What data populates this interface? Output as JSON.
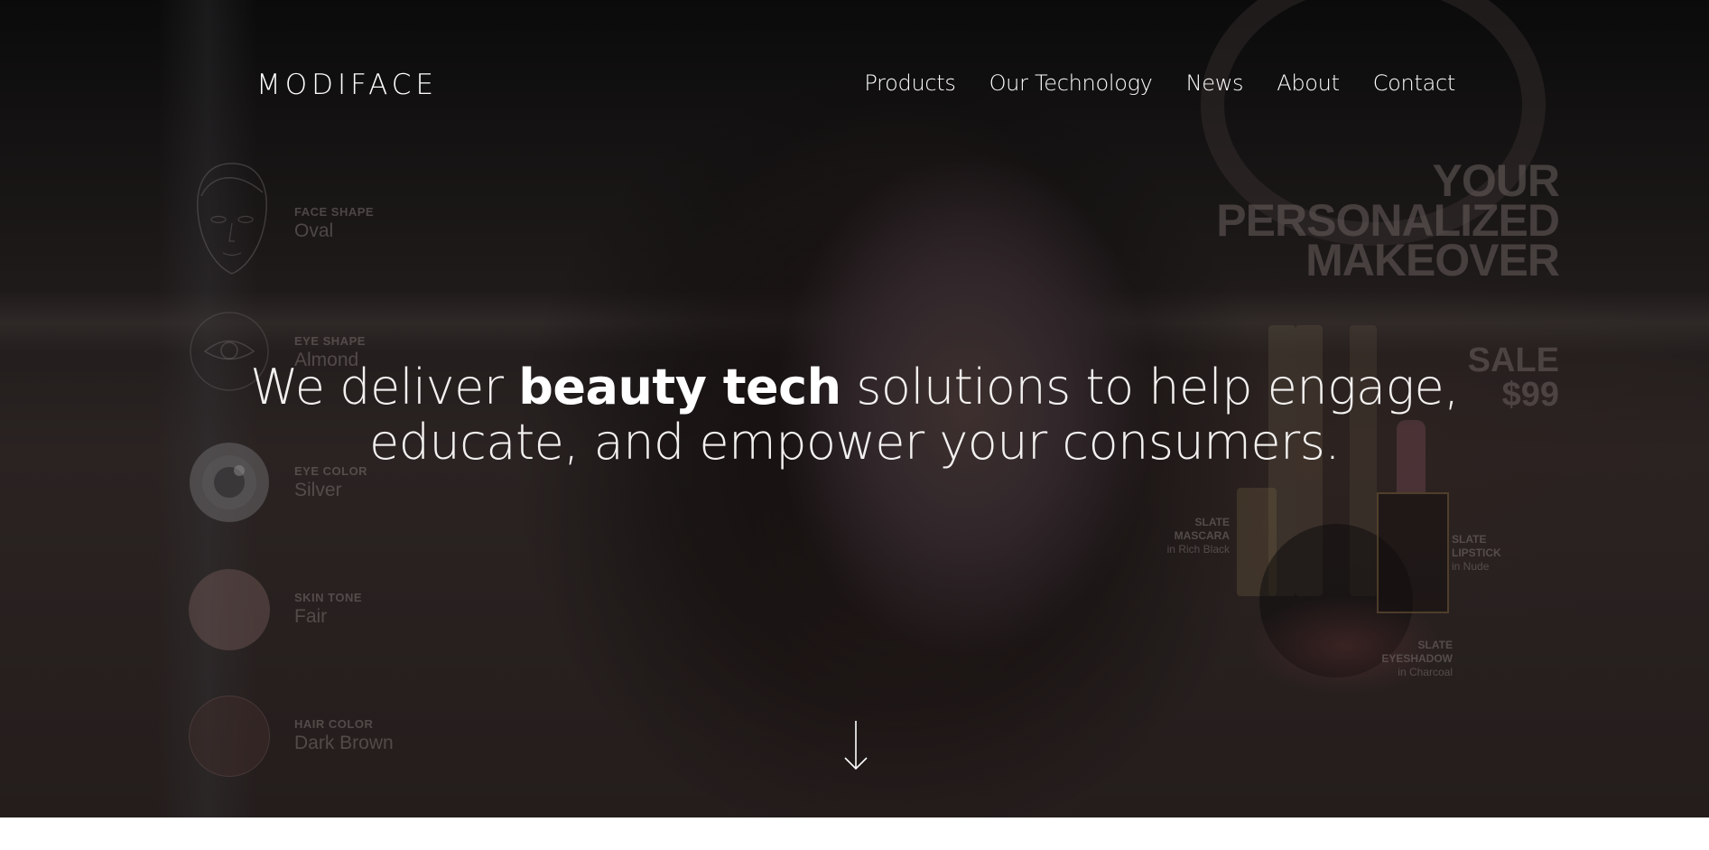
{
  "header": {
    "logo": "MODIFACE",
    "nav": [
      {
        "label": "Products"
      },
      {
        "label": "Our Technology"
      },
      {
        "label": "News"
      },
      {
        "label": "About"
      },
      {
        "label": "Contact"
      }
    ]
  },
  "hero": {
    "headline_pre": "We deliver ",
    "headline_strong": "beauty tech",
    "headline_post_line1": " solutions to help engage,",
    "headline_line2": "educate, and empower your consumers.",
    "scroll_icon": "arrow-down-icon"
  },
  "analysis": [
    {
      "title": "FACE SHAPE",
      "value": "Oval",
      "icon": "face-outline-icon"
    },
    {
      "title": "EYE SHAPE",
      "value": "Almond",
      "icon": "eye-outline-icon"
    },
    {
      "title": "EYE COLOR",
      "value": "Silver",
      "icon": "eye-color-swatch",
      "color": "#8c8a8c"
    },
    {
      "title": "SKIN TONE",
      "value": "Fair",
      "icon": "skin-tone-swatch",
      "color": "#7a5c58"
    },
    {
      "title": "HAIR COLOR",
      "value": "Dark Brown",
      "icon": "hair-color-swatch",
      "color": "#3e2a28"
    }
  ],
  "promo": {
    "headline_lines": [
      "YOUR",
      "PERSONALIZED",
      "MAKEOVER"
    ],
    "sale_label": "SALE",
    "sale_price": "$99",
    "products": [
      {
        "name_line1": "SLATE",
        "name_line2": "MASCARA",
        "shade": "in Rich Black"
      },
      {
        "name_line1": "SLATE",
        "name_line2": "LIPSTICK",
        "shade": "in Nude"
      },
      {
        "name_line1": "SLATE",
        "name_line2": "EYESHADOW",
        "shade": "in Charcoal"
      }
    ]
  },
  "colors": {
    "text": "#ffffff",
    "background_dark": "#1f1a1a",
    "page_background": "#ffffff"
  }
}
